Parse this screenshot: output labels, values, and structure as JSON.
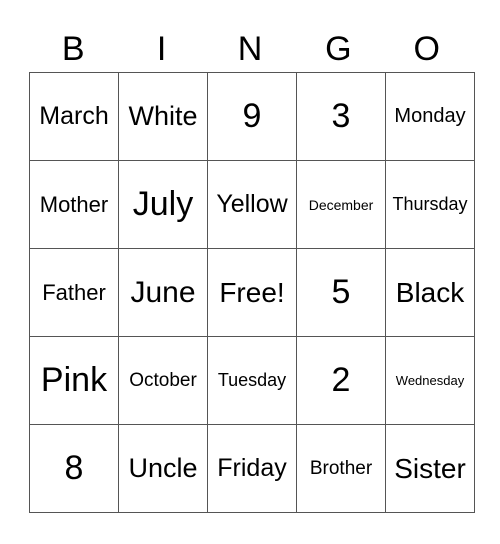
{
  "header": [
    "B",
    "I",
    "N",
    "G",
    "O"
  ],
  "rows": [
    [
      {
        "t": "March",
        "s": 25
      },
      {
        "t": "White",
        "s": 27
      },
      {
        "t": "9",
        "s": 34
      },
      {
        "t": "3",
        "s": 34
      },
      {
        "t": "Monday",
        "s": 20
      }
    ],
    [
      {
        "t": "Mother",
        "s": 22
      },
      {
        "t": "July",
        "s": 34
      },
      {
        "t": "Yellow",
        "s": 25
      },
      {
        "t": "December",
        "s": 14
      },
      {
        "t": "Thursday",
        "s": 18
      }
    ],
    [
      {
        "t": "Father",
        "s": 22
      },
      {
        "t": "June",
        "s": 30
      },
      {
        "t": "Free!",
        "s": 28
      },
      {
        "t": "5",
        "s": 34
      },
      {
        "t": "Black",
        "s": 28
      }
    ],
    [
      {
        "t": "Pink",
        "s": 34
      },
      {
        "t": "October",
        "s": 19
      },
      {
        "t": "Tuesday",
        "s": 18
      },
      {
        "t": "2",
        "s": 34
      },
      {
        "t": "Wednesday",
        "s": 13
      }
    ],
    [
      {
        "t": "8",
        "s": 34
      },
      {
        "t": "Uncle",
        "s": 27
      },
      {
        "t": "Friday",
        "s": 25
      },
      {
        "t": "Brother",
        "s": 19
      },
      {
        "t": "Sister",
        "s": 28
      }
    ]
  ]
}
